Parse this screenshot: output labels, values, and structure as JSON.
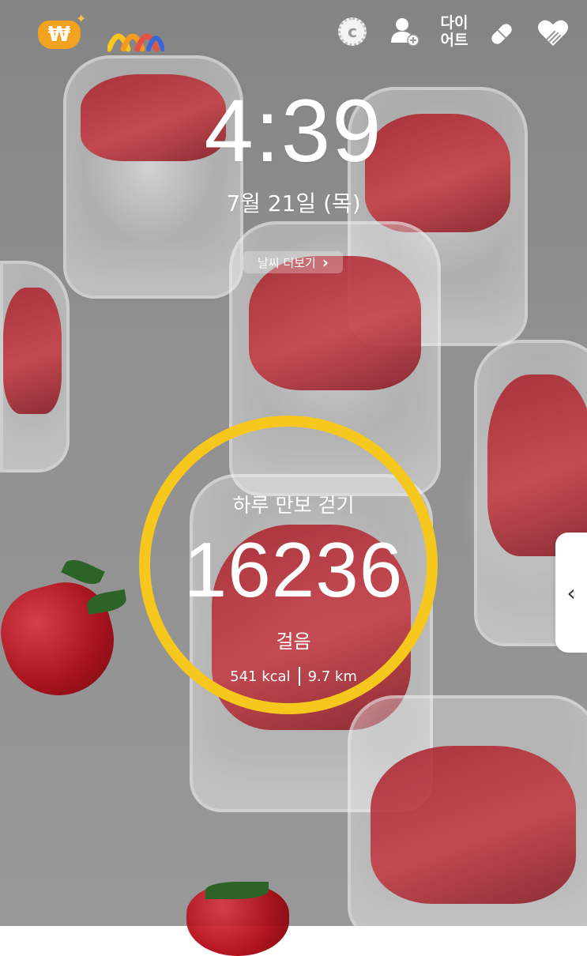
{
  "topbar": {
    "won_icon_symbol": "₩",
    "coin_icon_letter": "c",
    "diet_label_line1": "다이",
    "diet_label_line2": "어트",
    "icons": [
      "won-sparkle-icon",
      "arc-logo-icon",
      "coin-icon",
      "add-user-icon",
      "pill-icon",
      "heart-hand-icon"
    ]
  },
  "clock": {
    "time": "4:39",
    "date": "7월 21일 (목)"
  },
  "weather": {
    "label": "날씨 더보기",
    "chevron": "›"
  },
  "pedometer": {
    "title": "하루 만보 걷기",
    "steps": "16236",
    "unit": "걸음",
    "calories": "541 kcal",
    "distance": "9.7 km",
    "ring_color": "#f6c71c"
  },
  "side_panel": {
    "chevron": "‹"
  }
}
